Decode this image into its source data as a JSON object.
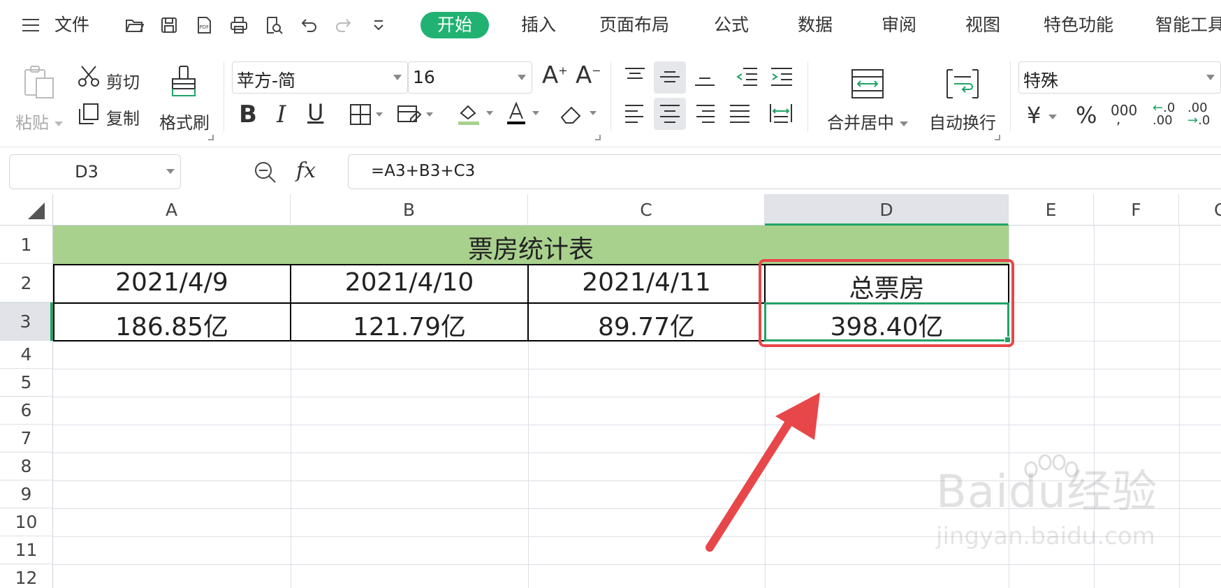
{
  "menubar": {
    "file": "文件",
    "tabs": [
      "开始",
      "插入",
      "页面布局",
      "公式",
      "数据",
      "审阅",
      "视图",
      "特色功能",
      "智能工具"
    ]
  },
  "ribbon": {
    "paste": "粘贴",
    "cut": "剪切",
    "copy": "复制",
    "format_painter": "格式刷",
    "font_name": "苹方-简",
    "font_size": "16",
    "merge_center": "合并居中",
    "auto_wrap": "自动换行",
    "number_format": "特殊",
    "currency_symbol": "¥",
    "percent_symbol": "%",
    "thousands_symbol": "000",
    "inc_decimal": ".00",
    "dec_decimal": ".0"
  },
  "formula_bar": {
    "name_box": "D3",
    "fx": "fx",
    "formula": "=A3+B3+C3"
  },
  "sheet": {
    "columns": [
      "A",
      "B",
      "C",
      "D",
      "E",
      "F",
      "G"
    ],
    "rows": [
      "1",
      "2",
      "3",
      "4",
      "5",
      "6",
      "7",
      "8",
      "9",
      "10",
      "11",
      "12"
    ],
    "title": "票房统计表",
    "headers": [
      "2021/4/9",
      "2021/4/10",
      "2021/4/11",
      "总票房"
    ],
    "values": [
      "186.85亿",
      "121.79亿",
      "89.77亿",
      "398.40亿"
    ],
    "active_cell": "D3"
  },
  "colors": {
    "accent": "#21b273",
    "title_fill": "#a9d18e",
    "annotation": "#e8474a"
  },
  "watermark": {
    "brand": "Baidu经验",
    "url": "jingyan.baidu.com"
  }
}
